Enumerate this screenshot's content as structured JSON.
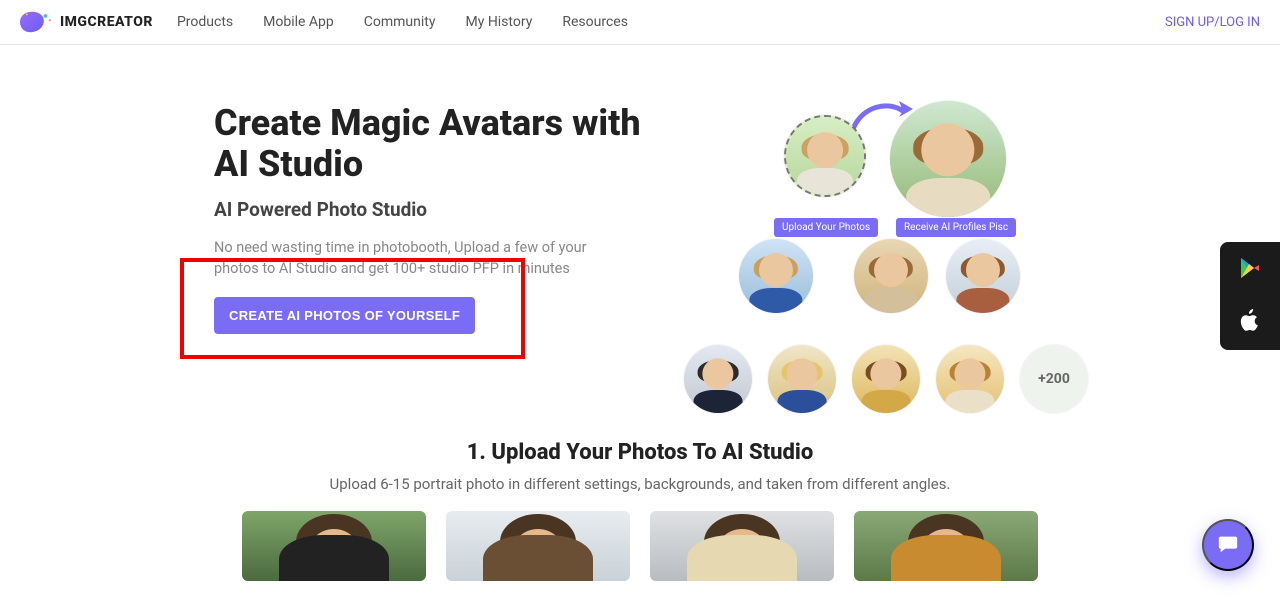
{
  "brand": {
    "name": "IMGCREATOR"
  },
  "nav": {
    "items": [
      "Products",
      "Mobile App",
      "Community",
      "My History",
      "Resources"
    ],
    "auth": "SIGN UP/LOG IN"
  },
  "hero": {
    "title": "Create Magic Avatars with AI Studio",
    "subtitle": "AI Powered Photo Studio",
    "description": "No need wasting time in photobooth, Upload a few of your photos to AI Studio and get 100+ studio PFP in minutes",
    "cta": "CREATE AI PHOTOS OF YOURSELF",
    "tag_upload": "Upload Your Photos",
    "tag_receive": "Receive AI Profiles Pisc",
    "more_count": "+200"
  },
  "section2": {
    "title": "1. Upload Your Photos To AI Studio",
    "description": "Upload 6-15 portrait photo in different settings, backgrounds, and taken from different angles."
  },
  "float": {
    "play_store": "google-play-icon",
    "app_store": "apple-icon",
    "chat": "chat-icon"
  }
}
